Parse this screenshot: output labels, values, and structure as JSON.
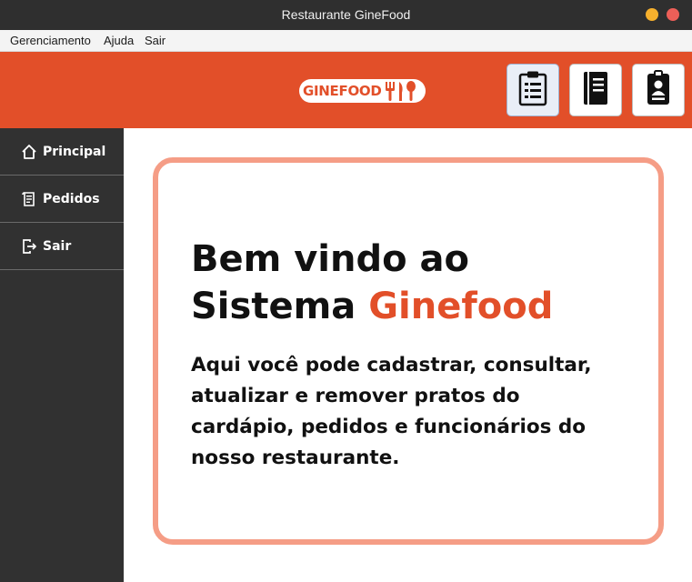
{
  "window": {
    "title": "Restaurante GineFood"
  },
  "menu": [
    "Gerenciamento",
    "Ajuda",
    "Sair"
  ],
  "header": {
    "logo_text": "GINEFOOD",
    "toolbar": [
      {
        "icon": "clipboard-icon",
        "active": true
      },
      {
        "icon": "notebook-icon",
        "active": false
      },
      {
        "icon": "id-badge-icon",
        "active": false
      }
    ]
  },
  "sidebar": {
    "items": [
      {
        "label": "Principal",
        "icon": "home-icon"
      },
      {
        "label": "Pedidos",
        "icon": "receipt-icon"
      },
      {
        "label": "Sair",
        "icon": "logout-icon"
      }
    ]
  },
  "welcome": {
    "title_prefix": "Bem vindo ao Sistema ",
    "title_accent": "Ginefood",
    "subtitle": "Aqui você pode cadastrar, consultar, atualizar e remover pratos do cardápio, pedidos e funcionários do nosso restaurante."
  },
  "colors": {
    "brand": "#e24f29",
    "card_border": "#f59d86",
    "sidebar_bg": "#313131",
    "titlebar_bg": "#2f2f2f"
  }
}
